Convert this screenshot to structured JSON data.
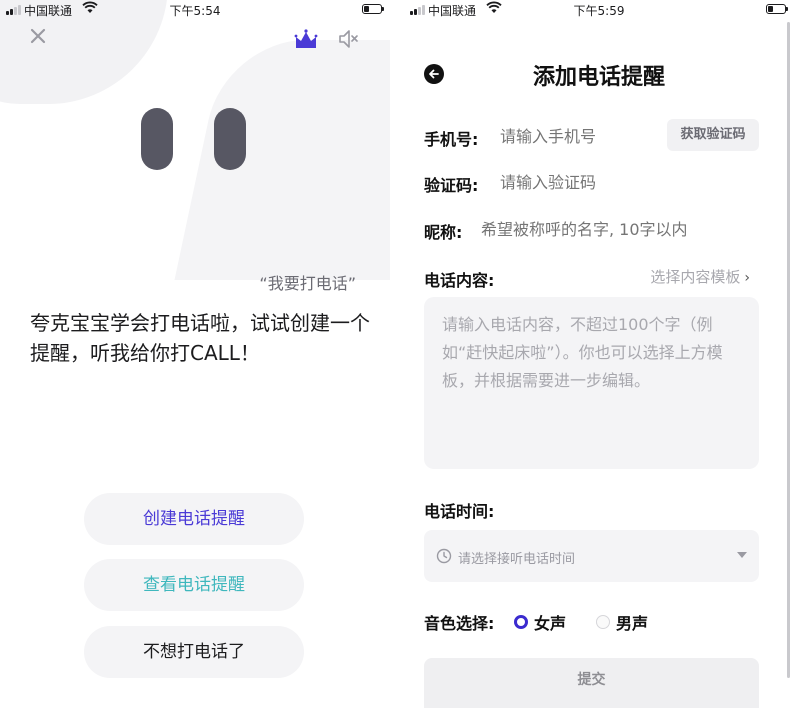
{
  "left": {
    "status": {
      "carrier": "中国联通",
      "time": "下午5:54"
    },
    "quote": "“我要打电话”",
    "intro": "夸克宝宝学会打电话啦，试试创建一个提醒，听我给你打CALL！",
    "buttons": {
      "create": "创建电话提醒",
      "view": "查看电话提醒",
      "decline": "不想打电话了"
    },
    "colors": {
      "create": "#4a3ad6",
      "view": "#3fb7bd"
    }
  },
  "right": {
    "status": {
      "carrier": "中国联通",
      "time": "下午5:59"
    },
    "title": "添加电话提醒",
    "phone": {
      "label": "手机号:",
      "placeholder": "请输入手机号",
      "code_button": "获取验证码"
    },
    "code": {
      "label": "验证码:",
      "placeholder": "请输入验证码"
    },
    "nickname": {
      "label": "昵称:",
      "placeholder": "希望被称呼的名字, 10字以内"
    },
    "content": {
      "label": "电话内容:",
      "template_link": "选择内容模板",
      "placeholder": "请输入电话内容，不超过100个字（例如“赶快起床啦”）。你也可以选择上方模板，并根据需要进一步编辑。"
    },
    "time": {
      "label": "电话时间:",
      "placeholder": "请选择接听电话时间"
    },
    "voice": {
      "label": "音色选择:",
      "female": "女声",
      "male": "男声",
      "selected": "女声"
    },
    "submit": "提交",
    "accent": "#3b2bcf"
  }
}
